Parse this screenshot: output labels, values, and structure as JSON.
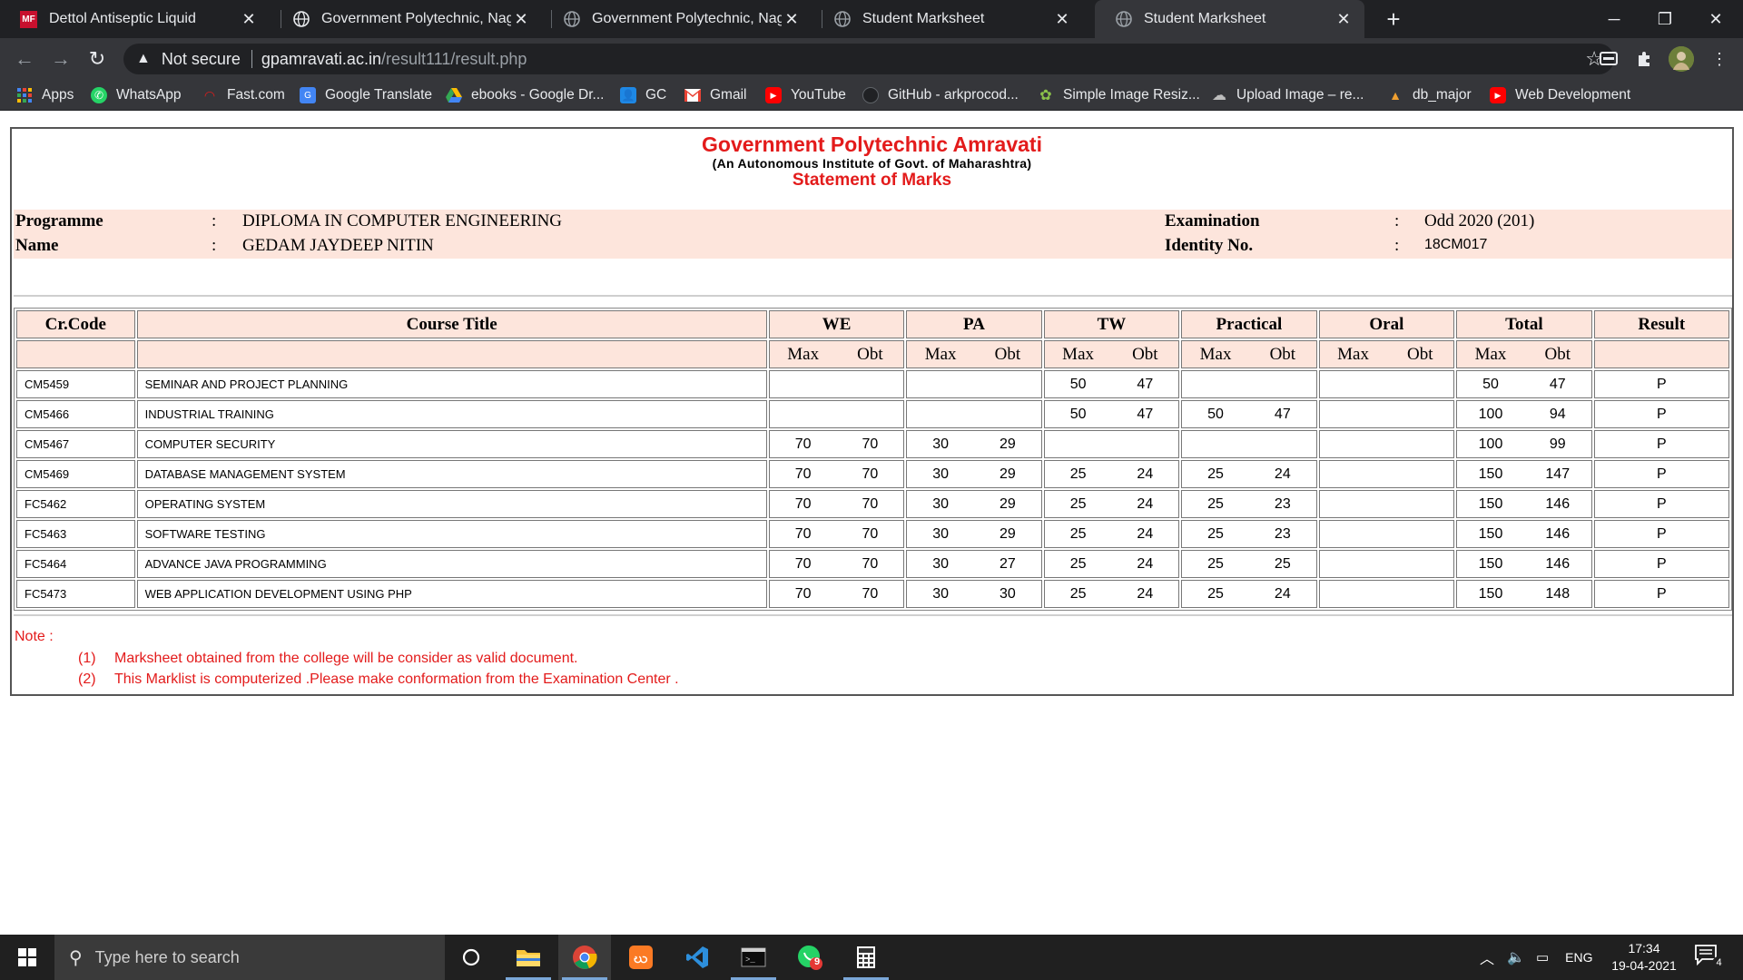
{
  "browser": {
    "tabs": [
      {
        "title": "Dettol Antiseptic Liquid",
        "active": false
      },
      {
        "title": "Government Polytechnic, Nagpur",
        "active": false
      },
      {
        "title": "Government Polytechnic, Nagpur",
        "active": false
      },
      {
        "title": "Student Marksheet",
        "active": false
      },
      {
        "title": "Student Marksheet",
        "active": true
      }
    ],
    "security_label": "Not secure",
    "url_host": "gpamravati.ac.in",
    "url_path": "/result111/result.php",
    "bookmarks": [
      "Apps",
      "WhatsApp",
      "Fast.com",
      "Google Translate",
      "ebooks - Google Dr...",
      "GC",
      "Gmail",
      "YouTube",
      "GitHub - arkprocod...",
      "Simple Image Resiz...",
      "Upload Image – re...",
      "db_major",
      "Web Development"
    ]
  },
  "header": {
    "institute": "Government Polytechnic Amravati",
    "subtitle": "(An Autonomous Institute of Govt. of Maharashtra)",
    "statement": "Statement of Marks"
  },
  "student": {
    "programme_label": "Programme",
    "programme": "DIPLOMA IN COMPUTER ENGINEERING",
    "name_label": "Name",
    "name": "GEDAM JAYDEEP NITIN",
    "exam_label": "Examination",
    "exam": "Odd 2020 (201)",
    "id_label": "Identity No.",
    "id": "18CM017",
    "colon": ":"
  },
  "table": {
    "headers": [
      "Cr.Code",
      "Course Title",
      "WE",
      "PA",
      "TW",
      "Practical",
      "Oral",
      "Total",
      "Result"
    ],
    "max_label": "Max",
    "obt_label": "Obt",
    "rows": [
      {
        "code": "CM5459",
        "title": "SEMINAR AND PROJECT PLANNING",
        "we": [
          "",
          ""
        ],
        "pa": [
          "",
          ""
        ],
        "tw": [
          "50",
          "47"
        ],
        "pr": [
          "",
          ""
        ],
        "or": [
          "",
          ""
        ],
        "tot": [
          "50",
          "47"
        ],
        "res": "P"
      },
      {
        "code": "CM5466",
        "title": "INDUSTRIAL TRAINING",
        "we": [
          "",
          ""
        ],
        "pa": [
          "",
          ""
        ],
        "tw": [
          "50",
          "47"
        ],
        "pr": [
          "50",
          "47"
        ],
        "or": [
          "",
          ""
        ],
        "tot": [
          "100",
          "94"
        ],
        "res": "P"
      },
      {
        "code": "CM5467",
        "title": "COMPUTER SECURITY",
        "we": [
          "70",
          "70"
        ],
        "pa": [
          "30",
          "29"
        ],
        "tw": [
          "",
          ""
        ],
        "pr": [
          "",
          ""
        ],
        "or": [
          "",
          ""
        ],
        "tot": [
          "100",
          "99"
        ],
        "res": "P"
      },
      {
        "code": "CM5469",
        "title": "DATABASE MANAGEMENT SYSTEM",
        "we": [
          "70",
          "70"
        ],
        "pa": [
          "30",
          "29"
        ],
        "tw": [
          "25",
          "24"
        ],
        "pr": [
          "25",
          "24"
        ],
        "or": [
          "",
          ""
        ],
        "tot": [
          "150",
          "147"
        ],
        "res": "P"
      },
      {
        "code": "FC5462",
        "title": "OPERATING SYSTEM",
        "we": [
          "70",
          "70"
        ],
        "pa": [
          "30",
          "29"
        ],
        "tw": [
          "25",
          "24"
        ],
        "pr": [
          "25",
          "23"
        ],
        "or": [
          "",
          ""
        ],
        "tot": [
          "150",
          "146"
        ],
        "res": "P"
      },
      {
        "code": "FC5463",
        "title": "SOFTWARE TESTING",
        "we": [
          "70",
          "70"
        ],
        "pa": [
          "30",
          "29"
        ],
        "tw": [
          "25",
          "24"
        ],
        "pr": [
          "25",
          "23"
        ],
        "or": [
          "",
          ""
        ],
        "tot": [
          "150",
          "146"
        ],
        "res": "P"
      },
      {
        "code": "FC5464",
        "title": "ADVANCE JAVA PROGRAMMING",
        "we": [
          "70",
          "70"
        ],
        "pa": [
          "30",
          "27"
        ],
        "tw": [
          "25",
          "24"
        ],
        "pr": [
          "25",
          "25"
        ],
        "or": [
          "",
          ""
        ],
        "tot": [
          "150",
          "146"
        ],
        "res": "P"
      },
      {
        "code": "FC5473",
        "title": "WEB APPLICATION DEVELOPMENT USING PHP",
        "we": [
          "70",
          "70"
        ],
        "pa": [
          "30",
          "30"
        ],
        "tw": [
          "25",
          "24"
        ],
        "pr": [
          "25",
          "24"
        ],
        "or": [
          "",
          ""
        ],
        "tot": [
          "150",
          "148"
        ],
        "res": "P"
      }
    ]
  },
  "notes": {
    "label": "Note :",
    "items": [
      {
        "num": "(1)",
        "text": "Marksheet obtained from the college will be consider as valid document."
      },
      {
        "num": "(2)",
        "text": "This Marklist is computerized .Please make conformation from the Examination Center ."
      }
    ]
  },
  "taskbar": {
    "search_placeholder": "Type here to search",
    "whatsapp_badge": "9",
    "language": "ENG",
    "time": "17:34",
    "date": "19-04-2021",
    "notification_count": "4"
  },
  "colors": {
    "accent_red": "#e31b1b",
    "header_fill": "#fde5dc"
  }
}
